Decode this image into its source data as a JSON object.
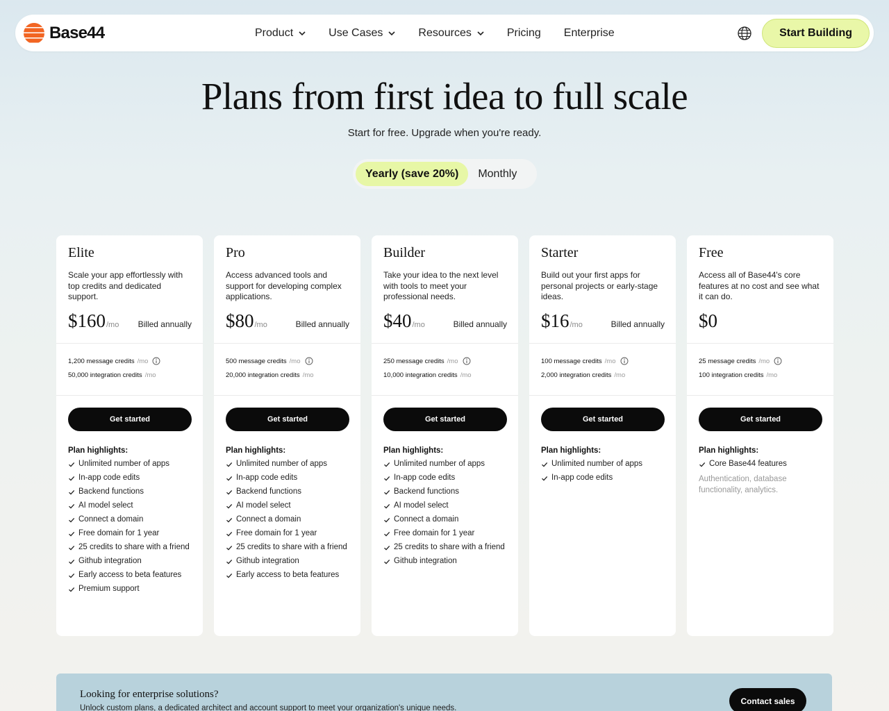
{
  "nav": {
    "logo_text": "Base44",
    "menu": [
      {
        "label": "Product",
        "has_dropdown": true
      },
      {
        "label": "Use Cases",
        "has_dropdown": true
      },
      {
        "label": "Resources",
        "has_dropdown": true
      },
      {
        "label": "Pricing",
        "has_dropdown": false
      },
      {
        "label": "Enterprise",
        "has_dropdown": false
      }
    ],
    "language_icon": "globe-icon",
    "cta_label": "Start Building"
  },
  "hero": {
    "title": "Plans from first idea to full scale",
    "subtitle": "Start for free. Upgrade when you're ready."
  },
  "billing_toggle": {
    "options": [
      "Yearly (save 20%)",
      "Monthly"
    ],
    "selected": "Yearly (save 20%)"
  },
  "plans": [
    {
      "name": "Elite",
      "description": "Scale your app effortlessly with top credits and dedicated support.",
      "price": "$160",
      "period": "/mo",
      "billing": "Billed annually",
      "message_credits": "1,200 message credits",
      "integration_credits": "50,000 integration credits",
      "credit_period": "/mo",
      "button": "Get started",
      "highlights_title": "Plan highlights:",
      "features": [
        "Unlimited number of apps",
        "In-app code edits",
        "Backend functions",
        "AI model select",
        "Connect a domain",
        "Free domain for 1 year",
        "25 credits to share with a friend",
        "Github integration",
        "Early access to beta features",
        "Premium support"
      ]
    },
    {
      "name": "Pro",
      "description": "Access advanced tools and support for developing complex applications.",
      "price": "$80",
      "period": "/mo",
      "billing": "Billed annually",
      "message_credits": "500 message credits",
      "integration_credits": "20,000 integration credits",
      "credit_period": "/mo",
      "button": "Get started",
      "highlights_title": "Plan highlights:",
      "features": [
        "Unlimited number of apps",
        "In-app code edits",
        "Backend functions",
        "AI model select",
        "Connect a domain",
        "Free domain for 1 year",
        "25 credits to share with a friend",
        "Github integration",
        "Early access to beta features"
      ]
    },
    {
      "name": "Builder",
      "description": "Take your idea to the next level with tools to meet your professional needs.",
      "price": "$40",
      "period": "/mo",
      "billing": "Billed annually",
      "message_credits": "250 message credits",
      "integration_credits": "10,000 integration credits",
      "credit_period": "/mo",
      "button": "Get started",
      "highlights_title": "Plan highlights:",
      "features": [
        "Unlimited number of apps",
        "In-app code edits",
        "Backend functions",
        "AI model select",
        "Connect a domain",
        "Free domain for 1 year",
        "25 credits to share with a friend",
        "Github integration"
      ]
    },
    {
      "name": "Starter",
      "description": "Build out your first apps for personal projects or early-stage ideas.",
      "price": "$16",
      "period": "/mo",
      "billing": "Billed annually",
      "message_credits": "100 message credits",
      "integration_credits": "2,000 integration credits",
      "credit_period": "/mo",
      "button": "Get started",
      "highlights_title": "Plan highlights:",
      "features": [
        "Unlimited number of apps",
        "In-app code edits"
      ]
    },
    {
      "name": "Free",
      "description": "Access all of Base44's core features at no cost and see what it can do.",
      "price": "$0",
      "period": "",
      "billing": "",
      "message_credits": "25 message credits",
      "integration_credits": "100 integration credits",
      "credit_period": "/mo",
      "button": "Get started",
      "highlights_title": "Plan highlights:",
      "features": [
        "Core Base44 features"
      ],
      "note": "Authentication, database functionality, analytics."
    }
  ],
  "enterprise": {
    "title": "Looking for enterprise solutions?",
    "subtitle": "Unlock custom plans, a dedicated architect and account support to meet your organization's unique needs.",
    "button": "Contact sales"
  },
  "colors": {
    "brand": "#f26522",
    "cta_bg": "#e9f7a8",
    "dark_button": "#0b0b0b",
    "enterprise_bg": "#b8d2dc"
  }
}
